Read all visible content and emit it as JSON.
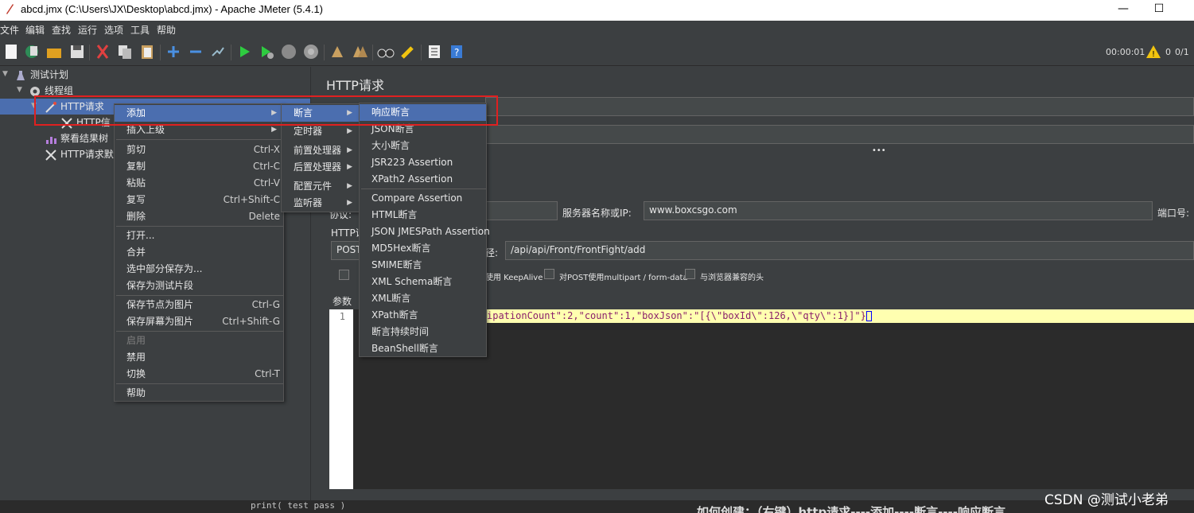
{
  "window": {
    "title": "abcd.jmx (C:\\Users\\JX\\Desktop\\abcd.jmx) - Apache JMeter (5.4.1)",
    "minimize": "—",
    "maximize": "☐"
  },
  "menubar": [
    "文件",
    "编辑",
    "查找",
    "运行",
    "选项",
    "工具",
    "帮助"
  ],
  "status": {
    "timer": "00:00:01",
    "warnings": "0",
    "threads": "0/1"
  },
  "tree": {
    "nodes": [
      "测试计划",
      "线程组",
      "HTTP请求",
      "HTTP信",
      "察看结果树",
      "HTTP请求默"
    ]
  },
  "panel": {
    "title": "HTTP请求",
    "protocol_label": "协议:",
    "server_label": "服务器名称或IP:",
    "server_value": "www.boxcsgo.com",
    "port_label": "端口号:",
    "http_label": "HTTP请",
    "method_value": "POST",
    "path_label": "径:",
    "path_value": "/api/api/Front/FrontFight/add",
    "keepalive_label": "使用 KeepAlive",
    "multipart_label": "对POST使用multipart / form-data",
    "browser_headers_label": "与浏览器兼容的头",
    "params_tab": "参数",
    "line_number": "1",
    "body_text": "ipationCount\":2,\"count\":1,\"boxJson\":\"[{\\\"boxId\\\":126,\\\"qty\\\":1}]\"}"
  },
  "context_menu": {
    "items": [
      {
        "label": "添加",
        "submenu": true,
        "highlight": true
      },
      {
        "label": "插入上级",
        "submenu": true
      },
      {
        "label": "剪切",
        "shortcut": "Ctrl-X"
      },
      {
        "label": "复制",
        "shortcut": "Ctrl-C"
      },
      {
        "label": "粘贴",
        "shortcut": "Ctrl-V"
      },
      {
        "label": "复写",
        "shortcut": "Ctrl+Shift-C"
      },
      {
        "label": "删除",
        "shortcut": "Delete"
      },
      {
        "label": "打开..."
      },
      {
        "label": "合并"
      },
      {
        "label": "选中部分保存为..."
      },
      {
        "label": "保存为测试片段"
      },
      {
        "label": "保存节点为图片",
        "shortcut": "Ctrl-G"
      },
      {
        "label": "保存屏幕为图片",
        "shortcut": "Ctrl+Shift-G"
      },
      {
        "label": "启用",
        "disabled": true
      },
      {
        "label": "禁用"
      },
      {
        "label": "切换",
        "shortcut": "Ctrl-T"
      },
      {
        "label": "帮助"
      }
    ]
  },
  "add_submenu": {
    "items": [
      "断言",
      "定时器",
      "前置处理器",
      "后置处理器",
      "配置元件",
      "监听器"
    ]
  },
  "assertion_submenu": {
    "items": [
      "响应断言",
      "JSON断言",
      "大小断言",
      "JSR223 Assertion",
      "XPath2 Assertion",
      "Compare Assertion",
      "HTML断言",
      "JSON JMESPath Assertion",
      "MD5Hex断言",
      "SMIME断言",
      "XML Schema断言",
      "XML断言",
      "XPath断言",
      "断言持续时间",
      "BeanShell断言"
    ]
  },
  "background": {
    "code": "print( test pass )",
    "caption": "如何创建：（右键）http请求----添加----断言----响应断言"
  },
  "watermark": "CSDN @测试小老弟",
  "colors": {
    "selection": "#4b6eaf",
    "annotation": "#e02020",
    "background": "#3c3f41"
  }
}
